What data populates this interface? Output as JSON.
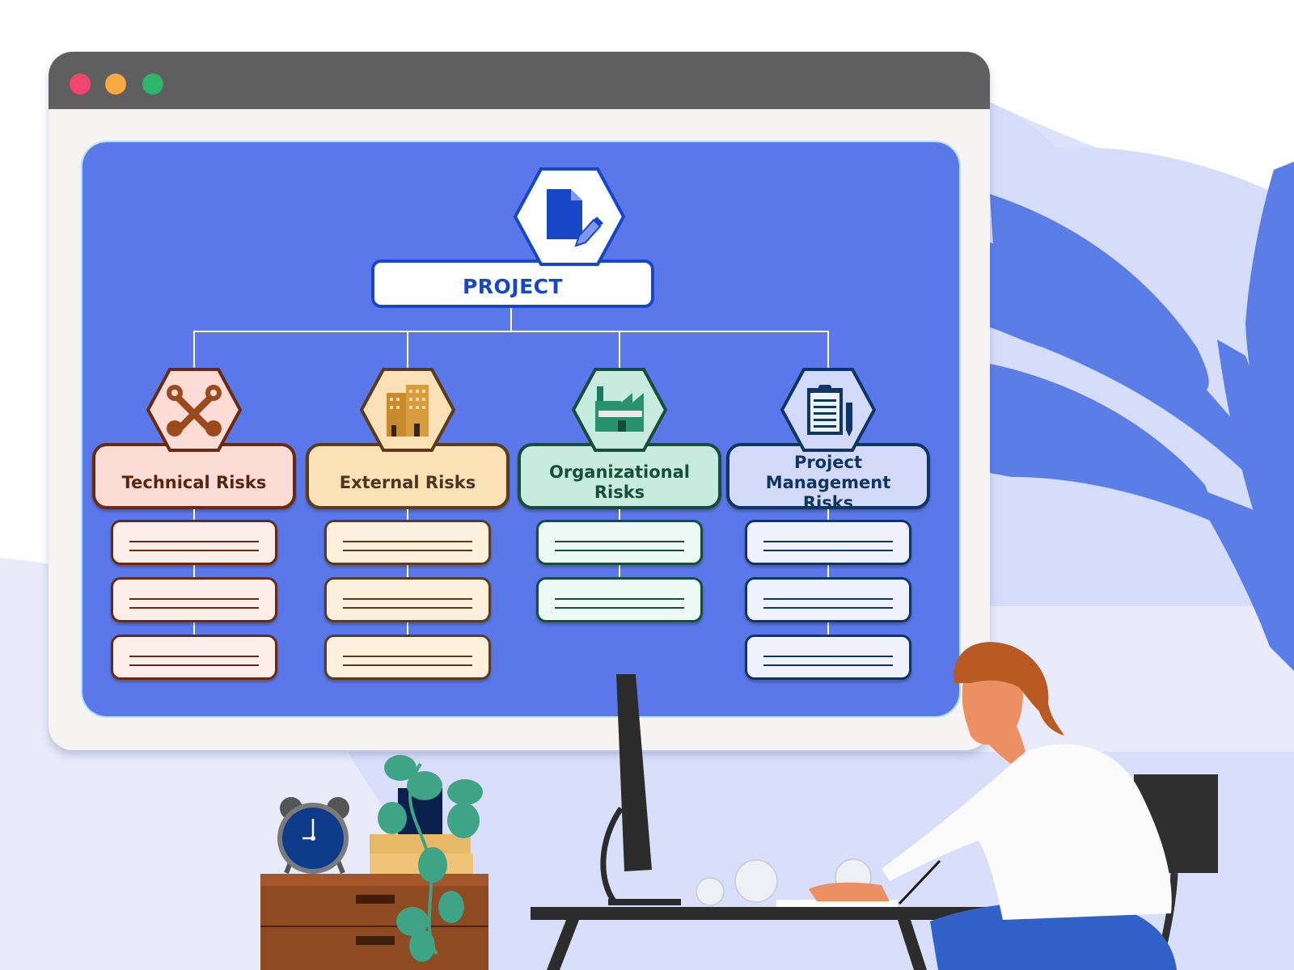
{
  "window": {
    "controls": [
      {
        "name": "close",
        "color": "#f2466e"
      },
      {
        "name": "minimize",
        "color": "#f9a940"
      },
      {
        "name": "maximize",
        "color": "#2fb46c"
      }
    ],
    "titlebar_color": "#5f5f5f",
    "canvas_color": "#5b78ea"
  },
  "diagram": {
    "root": {
      "label": "PROJECT",
      "icon": "document-edit-icon",
      "color": "#1746c6"
    },
    "categories": [
      {
        "label": "Technical Risks",
        "icon": "crossed-wrenches-icon",
        "fill": "#fcdcd5",
        "border": "#6b2a10",
        "text_color": "#5a2410",
        "item_fill": "#fdeee9",
        "item_count": 3
      },
      {
        "label": "External Risks",
        "icon": "office-building-icon",
        "fill": "#fce1b6",
        "border": "#5c3a1c",
        "text_color": "#4d3520",
        "item_fill": "#fdf0dc",
        "item_count": 3
      },
      {
        "label": "Organizational Risks",
        "icon": "factory-icon",
        "fill": "#c7ebdf",
        "border": "#164e3a",
        "text_color": "#164e3a",
        "item_fill": "#ecf9f5",
        "item_count": 2
      },
      {
        "label": "Project Management Risks",
        "icon": "clipboard-pen-icon",
        "fill": "#d3daf9",
        "border": "#0f3563",
        "text_color": "#0f3563",
        "item_fill": "#eff1fc",
        "item_count": 3
      }
    ]
  },
  "illustration": {
    "elements": [
      "alarm-clock",
      "potted-plant",
      "books",
      "wooden-drawer",
      "desk",
      "computer-monitor",
      "crumpled-paper",
      "person-writing",
      "chair",
      "decorative-leaves"
    ]
  }
}
